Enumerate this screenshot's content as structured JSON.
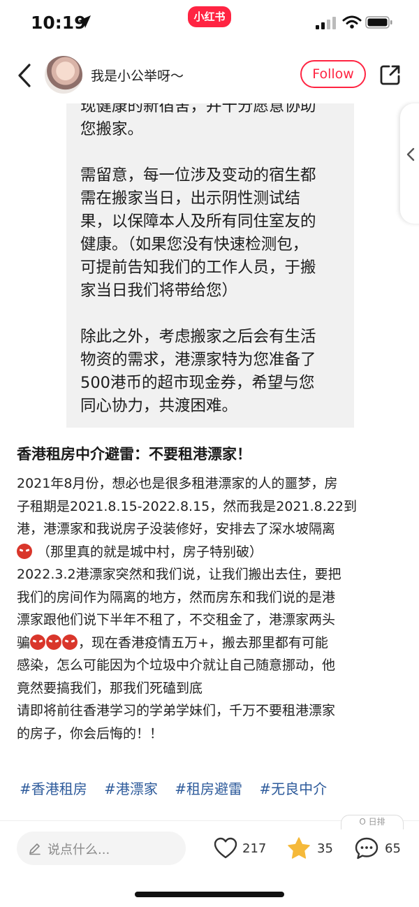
{
  "status_bar": {
    "time": "10:19",
    "app_logo": "小红书"
  },
  "header": {
    "author_name": "我是小公举呀～",
    "follow_label": "Follow"
  },
  "image_text": {
    "paragraphs": [
      "现健康的新宿舍，并十分愿意协助\n您搬家。",
      "需留意，每一位涉及变动的宿生都\n需在搬家当日，出示阴性测试结\n果，以保障本人及所有同住室友的\n健康。（如果您没有快速检测包，\n可提前告知我们的工作人员，于搬\n家当日我们将带给您）",
      "除此之外，考虑搬家之后会有生活\n物资的需求，港漂家特为您准备了\n500港币的超市现金券，希望与您\n同心协力，共渡困难。"
    ]
  },
  "post": {
    "title": "香港租房中介避雷：不要租港漂家！",
    "lines": {
      "l1": "2021年8月份，想必也是很多租港漂家的人的噩梦，房",
      "l2": "子租期是2021.8.15-2022.8.15，然而我是2021.8.22到",
      "l3": "港，港漂家和我说房子没装修好，安排去了深水坡隔离",
      "l4": "（那里真的就是城中村，房子特别破）",
      "l5": "2022.3.2港漂家突然和我们说，让我们搬出去住，要把",
      "l6": "我们的房间作为隔离的地方，然而房东和我们说的是港",
      "l7": "漂家跟他们说下半年不租了，不交租金了，港漂家两头",
      "l8a": "骗",
      "l8b": "，现在香港疫情五万+，搬去那里都有可能",
      "l9": "感染，怎么可能因为个垃圾中介就让自己随意挪动，他",
      "l10": "竟然要搞我们，那我们死磕到底",
      "l11": "请即将前往香港学习的学弟学妹们，千万不要租港漂家",
      "l12": "的房子，你会后悔的！！"
    },
    "tags": [
      "#香港租房",
      "#港漂家",
      "#租房避雷",
      "#无良中介"
    ]
  },
  "bottom_bar": {
    "comment_placeholder": "说点什么...",
    "likes": "217",
    "collects": "35",
    "comments": "65",
    "partial_pill": "Ο 日排"
  },
  "colors": {
    "brand_red": "#ff2442",
    "tag_blue": "#2e5b9b",
    "star_gold": "#f5b93a"
  }
}
